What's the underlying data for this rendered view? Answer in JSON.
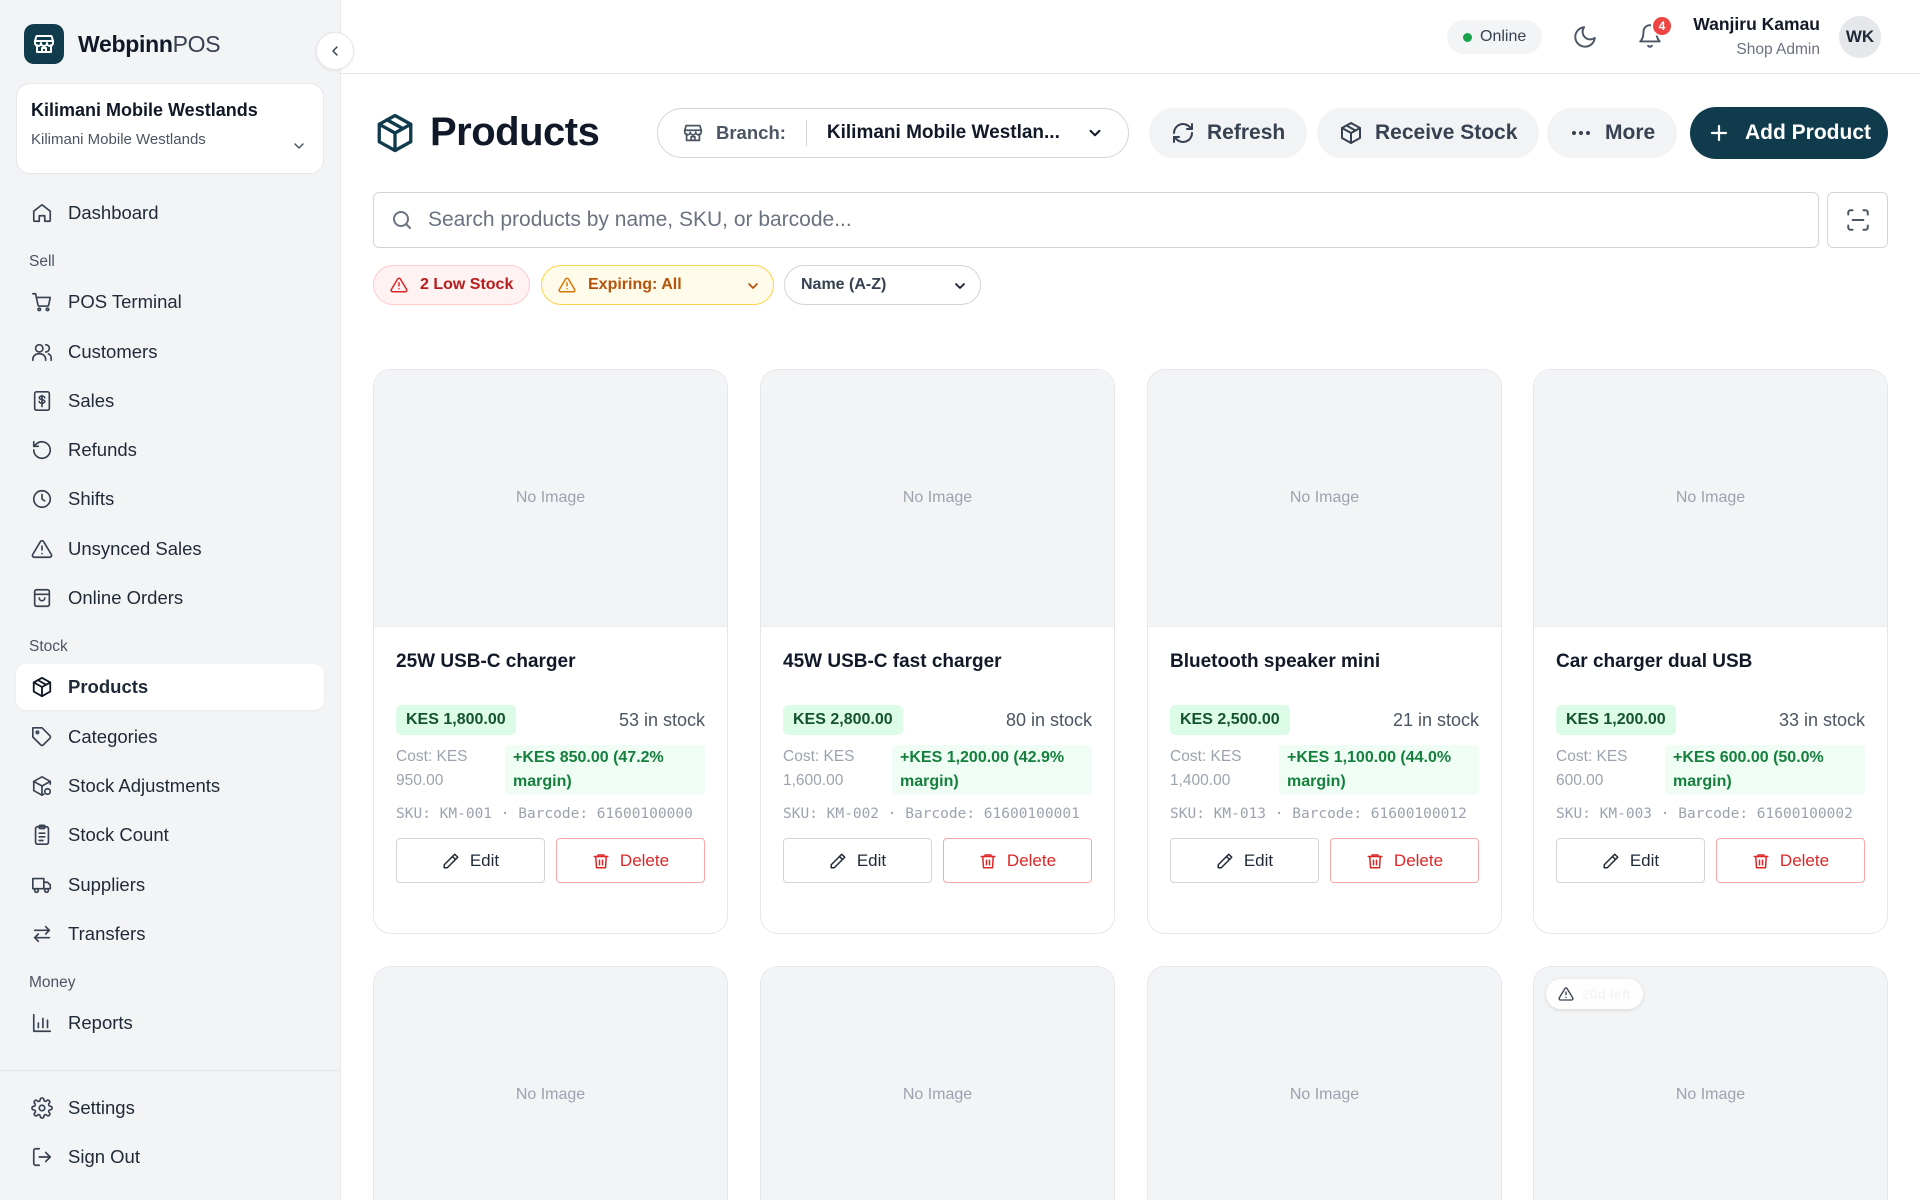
{
  "brand": {
    "name_bold": "Webpinn",
    "name_light": "POS"
  },
  "branch_card": {
    "name": "Kilimani Mobile Westlands",
    "subtitle": "Kilimani Mobile Westlands"
  },
  "nav": {
    "dashboard": "Dashboard",
    "sections": {
      "sell": "Sell",
      "stock": "Stock",
      "money": "Money"
    },
    "sell_items": [
      "POS Terminal",
      "Customers",
      "Sales",
      "Refunds",
      "Shifts",
      "Unsynced Sales",
      "Online Orders"
    ],
    "stock_items": [
      "Products",
      "Categories",
      "Stock Adjustments",
      "Stock Count",
      "Suppliers",
      "Transfers"
    ],
    "money_items": [
      "Reports"
    ],
    "bottom_items": [
      "Settings",
      "Sign Out"
    ],
    "active": "Products"
  },
  "topbar": {
    "status": "Online",
    "notification_count": "4",
    "user_name": "Wanjiru Kamau",
    "user_role": "Shop Admin",
    "avatar_initials": "WK"
  },
  "page": {
    "title": "Products",
    "branch_label": "Branch:",
    "branch_value": "Kilimani Mobile Westlan...",
    "refresh": "Refresh",
    "receive_stock": "Receive Stock",
    "more": "More",
    "add_product": "Add Product"
  },
  "search": {
    "placeholder": "Search products by name, SKU, or barcode..."
  },
  "filters": {
    "low_stock": "2 Low Stock",
    "expiring": "Expiring: All",
    "sort": "Name (A-Z)"
  },
  "no_image": "No Image",
  "edit_label": "Edit",
  "delete_label": "Delete",
  "products": [
    {
      "name": "25W USB-C charger",
      "price": "KES 1,800.00",
      "stock": "53 in stock",
      "cost": "Cost: KES 950.00",
      "margin": "+KES 850.00 (47.2% margin)",
      "sku": "SKU: KM-001 · Barcode: 61600100000"
    },
    {
      "name": "45W USB-C fast charger",
      "price": "KES 2,800.00",
      "stock": "80 in stock",
      "cost": "Cost: KES 1,600.00",
      "margin": "+KES 1,200.00 (42.9% margin)",
      "sku": "SKU: KM-002 · Barcode: 61600100001"
    },
    {
      "name": "Bluetooth speaker mini",
      "price": "KES 2,500.00",
      "stock": "21 in stock",
      "cost": "Cost: KES 1,400.00",
      "margin": "+KES 1,100.00 (44.0% margin)",
      "sku": "SKU: KM-013 · Barcode: 61600100012"
    },
    {
      "name": "Car charger dual USB",
      "price": "KES 1,200.00",
      "stock": "33 in stock",
      "cost": "Cost: KES 600.00",
      "margin": "+KES 600.00 (50.0% margin)",
      "sku": "SKU: KM-003 · Barcode: 61600100002"
    }
  ],
  "row2_expiry_badge": "20d left",
  "colors": {
    "primary": "#0f3b4c",
    "online": "#16a34a",
    "danger": "#dc2626",
    "warning": "#b45309",
    "success_bg": "#dcfce7"
  }
}
